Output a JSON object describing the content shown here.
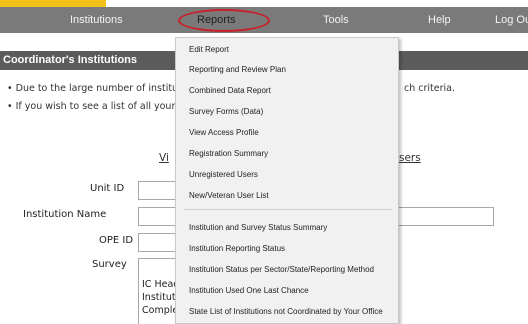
{
  "nav": {
    "institutions": "Institutions",
    "reports": "Reports",
    "tools": "Tools",
    "help": "Help",
    "logout": "Log Out"
  },
  "section": {
    "title": "Coordinator's Institutions"
  },
  "info": {
    "line1": "• Due to the large number of institu",
    "line1_tail": "ch criteria.",
    "line2": "• If you wish to see a list of all your"
  },
  "links": {
    "left": "Vi",
    "right": "sers"
  },
  "form": {
    "unit_id_label": "Unit ID",
    "institution_name_label": "Institution Name",
    "ope_id_label": "OPE ID",
    "survey_label": "Survey",
    "survey_lines": [
      "IC Head",
      "Instituti",
      "Complet"
    ]
  },
  "menu": {
    "items": [
      "Edit Report",
      "Reporting and Review Plan",
      "Combined Data Report",
      "Survey Forms (Data)",
      "View Access Profile",
      "Registration Summary",
      "Unregistered Users",
      "New/Veteran User List",
      "Institution and Survey Status Summary",
      "Institution Reporting Status",
      "Institution Status per Sector/State/Reporting Method",
      "Institution Used One Last Chance",
      "State List of Institutions not Coordinated by Your Office"
    ]
  },
  "colors": {
    "nav_bg": "#7a7a7a",
    "section_bg": "#5c5c5c",
    "highlight": "#f3c21a",
    "annotation_ring": "#c8202a",
    "menu_bg": "#f1f1f1"
  }
}
